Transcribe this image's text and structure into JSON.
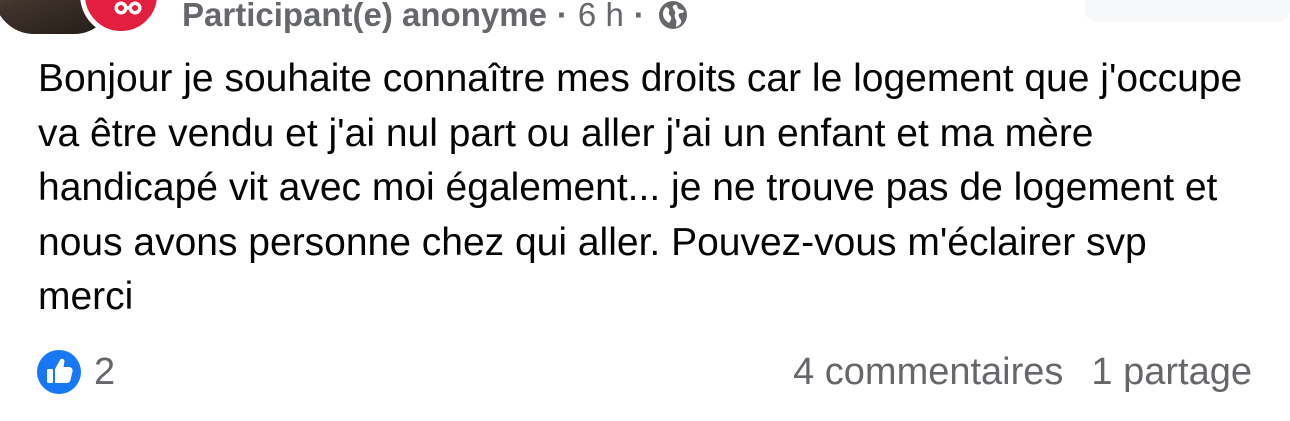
{
  "post": {
    "author": "Participant(e) anonyme",
    "separator": "·",
    "time": "6 h",
    "text": "Bonjour je souhaite connaître mes droits car le logement que j'occupe va être vendu et j'ai nul part ou aller j'ai un enfant et ma mère handicapé vit avec moi également... je ne trouve pas de logement et nous avons personne chez qui aller. Pouvez-vous m'éclairer svp merci",
    "audience_icon": "globe-icon",
    "badge_icon": "anonymous-glasses-icon"
  },
  "footer": {
    "reaction_icon": "like-icon",
    "reaction_count": "2",
    "comments": "4 commentaires",
    "shares": "1 partage"
  },
  "colors": {
    "text_primary": "#050505",
    "text_secondary": "#65676b",
    "like_blue": "#1877f2",
    "badge_red": "#e41e3f"
  }
}
